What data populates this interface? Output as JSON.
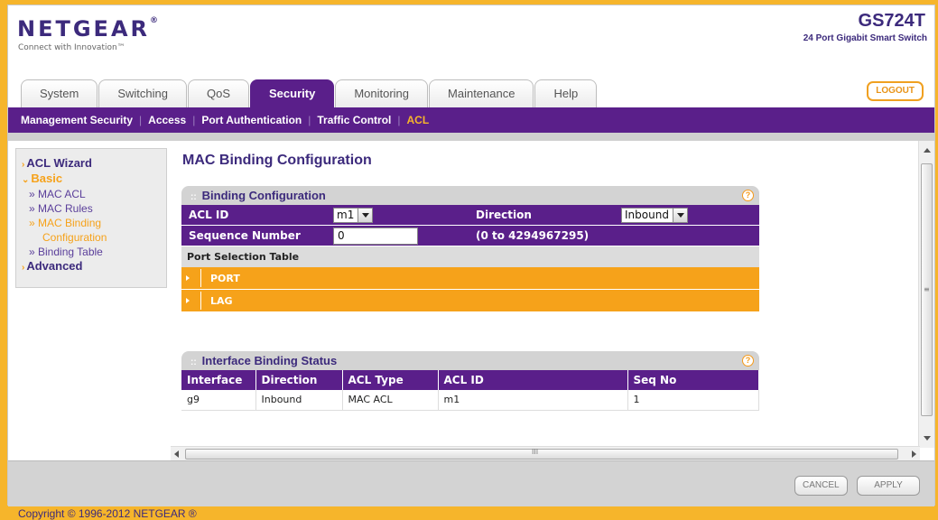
{
  "header": {
    "logo": "NETGEAR",
    "tagline": "Connect with Innovation™",
    "model": "GS724T",
    "model_desc": "24 Port Gigabit Smart Switch",
    "logout": "LOGOUT"
  },
  "tabs": [
    {
      "label": "System"
    },
    {
      "label": "Switching"
    },
    {
      "label": "QoS"
    },
    {
      "label": "Security"
    },
    {
      "label": "Monitoring"
    },
    {
      "label": "Maintenance"
    },
    {
      "label": "Help"
    }
  ],
  "subnav": [
    {
      "label": "Management Security"
    },
    {
      "label": "Access"
    },
    {
      "label": "Port Authentication"
    },
    {
      "label": "Traffic Control"
    },
    {
      "label": "ACL"
    }
  ],
  "sidebar": {
    "acl_wizard": "ACL Wizard",
    "basic": "Basic",
    "mac_acl": "» MAC ACL",
    "mac_rules": "» MAC Rules",
    "mac_binding_1": "» MAC Binding",
    "mac_binding_2": "Configuration",
    "binding_table": "» Binding Table",
    "advanced": "Advanced"
  },
  "page_title": "MAC Binding Configuration",
  "binding": {
    "title": "Binding Configuration",
    "acl_id_label": "ACL ID",
    "acl_id_value": "m1",
    "direction_label": "Direction",
    "direction_value": "Inbound",
    "seq_label": "Sequence Number",
    "seq_value": "0",
    "seq_range": "(0 to 4294967295)",
    "port_table_label": "Port Selection Table",
    "port": "PORT",
    "lag": "LAG"
  },
  "status": {
    "title": "Interface Binding Status",
    "columns": [
      "Interface",
      "Direction",
      "ACL Type",
      "ACL ID",
      "Seq No"
    ],
    "rows": [
      [
        "g9",
        "Inbound",
        "MAC ACL",
        "m1",
        "1"
      ]
    ]
  },
  "buttons": {
    "cancel": "CANCEL",
    "apply": "APPLY"
  },
  "copyright": "Copyright © 1996-2012 NETGEAR ®",
  "colors": {
    "purple": "#5a1f8a",
    "orange": "#f6a21a",
    "brand": "#3c2a7c"
  }
}
